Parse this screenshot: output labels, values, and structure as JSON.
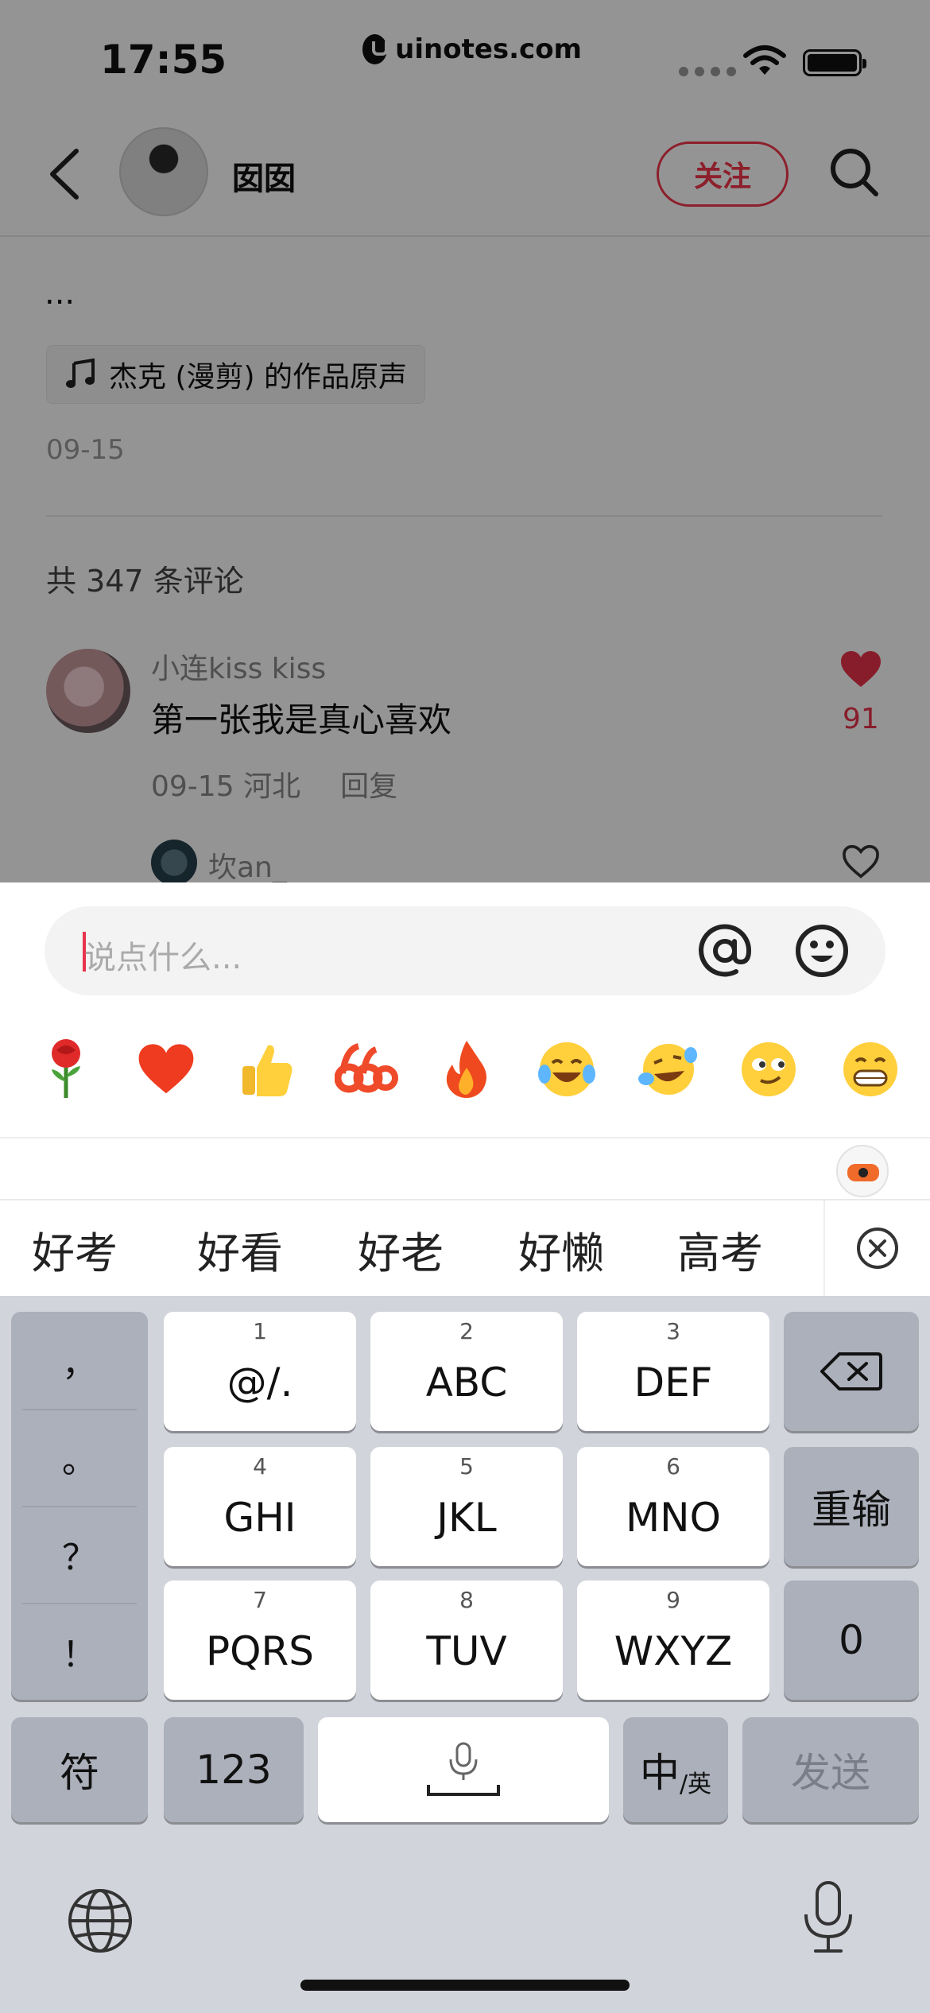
{
  "status": {
    "time": "17:55",
    "url": "uinotes.com"
  },
  "header": {
    "nickname": "囡囡",
    "follow_label": "关注"
  },
  "post": {
    "ellipsis": "...",
    "music": "杰克 (漫剪) 的作品原声",
    "date": "09-15"
  },
  "comments": {
    "count_label": "共 347 条评论",
    "items": [
      {
        "user": "小连kiss kiss",
        "text": "第一张我是真心喜欢",
        "date": "09-15",
        "location": "河北",
        "reply_label": "回复",
        "likes": "91"
      }
    ],
    "reply_preview": {
      "user": "坎an_"
    }
  },
  "composer": {
    "placeholder": "说点什么..."
  },
  "emoji_bar": [
    "rose-emoji",
    "heart-emoji",
    "thumbs-up-emoji",
    "666-emoji",
    "fire-emoji",
    "laugh-tears-emoji",
    "rolling-laugh-emoji",
    "smirk-emoji",
    "grin-emoji"
  ],
  "candidates": [
    "好考",
    "好看",
    "好老",
    "好懒",
    "高考"
  ],
  "keyboard": {
    "punctuation": [
      "，",
      "。",
      "？",
      "！"
    ],
    "keys": [
      {
        "num": "1",
        "label": "@/."
      },
      {
        "num": "2",
        "label": "ABC"
      },
      {
        "num": "3",
        "label": "DEF"
      },
      {
        "num": "4",
        "label": "GHI"
      },
      {
        "num": "5",
        "label": "JKL"
      },
      {
        "num": "6",
        "label": "MNO"
      },
      {
        "num": "7",
        "label": "PQRS"
      },
      {
        "num": "8",
        "label": "TUV"
      },
      {
        "num": "9",
        "label": "WXYZ"
      }
    ],
    "reenter_label": "重输",
    "zero_label": "0",
    "symbols_label": "符",
    "numbers_label": "123",
    "lang_main": "中",
    "lang_sub": "/英",
    "send_label": "发送"
  },
  "colors": {
    "accent": "#f2364b",
    "like": "#e8334a"
  }
}
